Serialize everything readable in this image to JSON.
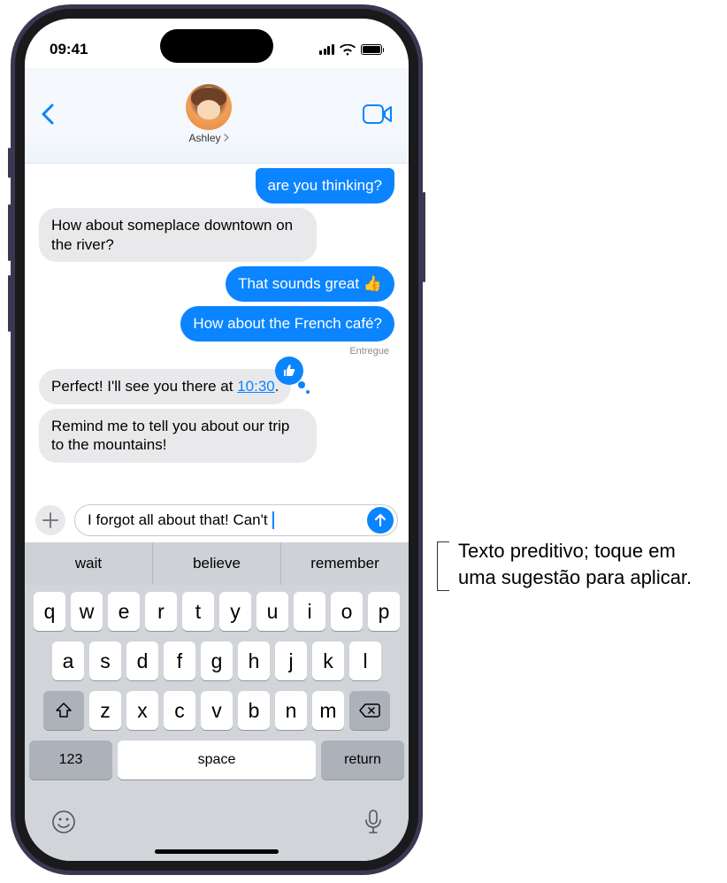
{
  "status": {
    "time": "09:41"
  },
  "nav": {
    "contact_name": "Ashley"
  },
  "messages": {
    "out_partial": "are you thinking?",
    "in_1": "How about someplace downtown on the river?",
    "out_2_pre": "That sounds great ",
    "out_3": "How about the French café?",
    "delivered": "Entregue",
    "in_2_pre": "Perfect! I'll see you there at ",
    "in_2_time": "10:30",
    "in_2_post": ".",
    "in_3": "Remind me to tell you about our trip to the mountains!"
  },
  "input": {
    "text": "I forgot all about that! Can't "
  },
  "predictive": {
    "p1": "wait",
    "p2": "believe",
    "p3": "remember"
  },
  "keyboard": {
    "row1": [
      "q",
      "w",
      "e",
      "r",
      "t",
      "y",
      "u",
      "i",
      "o",
      "p"
    ],
    "row2": [
      "a",
      "s",
      "d",
      "f",
      "g",
      "h",
      "j",
      "k",
      "l"
    ],
    "row3": [
      "z",
      "x",
      "c",
      "v",
      "b",
      "n",
      "m"
    ],
    "num": "123",
    "space": "space",
    "return": "return"
  },
  "callout": {
    "text": "Texto preditivo; toque em uma sugestão para aplicar."
  }
}
